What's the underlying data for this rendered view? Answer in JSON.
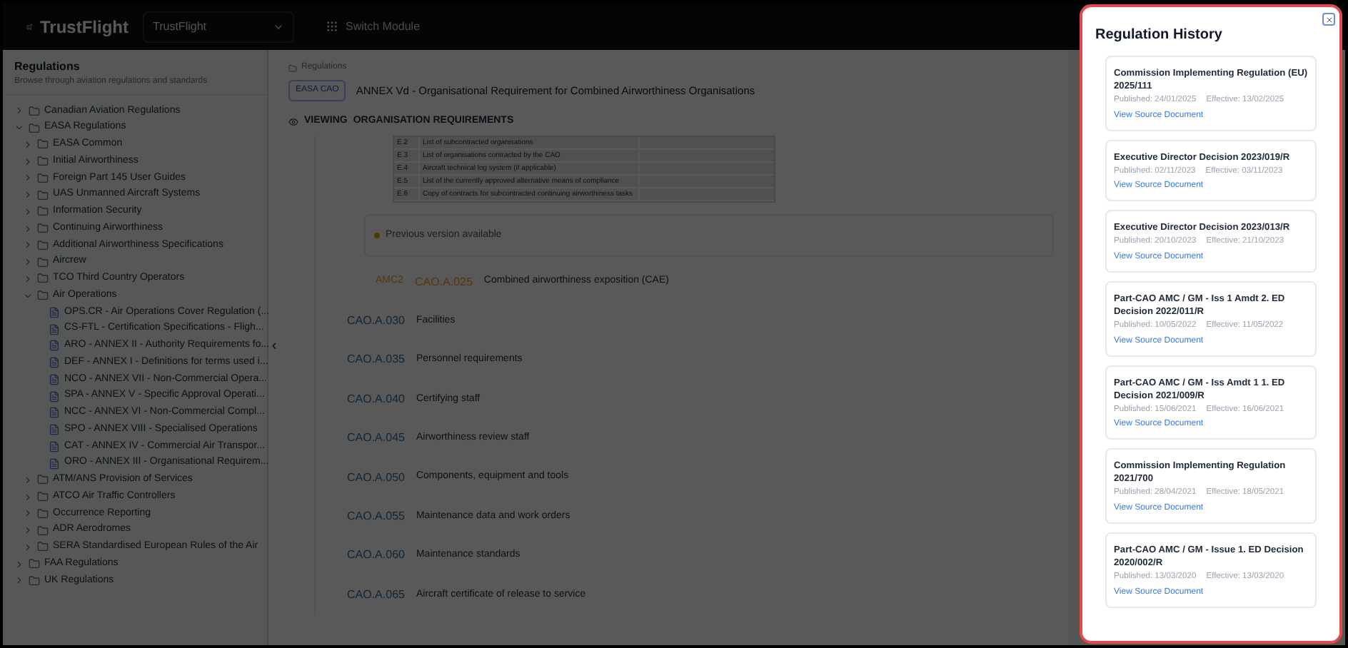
{
  "header": {
    "logo": "TrustFlight",
    "org_select": "TrustFlight",
    "switch_module": "Switch Module"
  },
  "sidebar": {
    "title": "Regulations",
    "subtitle": "Browse through aviation regulations and standards",
    "collapse": "‹",
    "items": [
      {
        "kind": "folder",
        "label": "Canadian Aviation Regulations",
        "expanded": false
      },
      {
        "kind": "folder",
        "label": "EASA Regulations",
        "expanded": true,
        "children": [
          {
            "kind": "folder",
            "label": "EASA Common",
            "expanded": false
          },
          {
            "kind": "folder",
            "label": "Initial Airworthiness",
            "expanded": false
          },
          {
            "kind": "folder",
            "label": "Foreign Part 145 User Guides",
            "expanded": false
          },
          {
            "kind": "folder",
            "label": "UAS Unmanned Aircraft Systems",
            "expanded": false
          },
          {
            "kind": "folder",
            "label": "Information Security",
            "expanded": false
          },
          {
            "kind": "folder",
            "label": "Continuing Airworthiness",
            "expanded": false
          },
          {
            "kind": "folder",
            "label": "Additional Airworthiness Specifications",
            "expanded": false
          },
          {
            "kind": "folder",
            "label": "Aircrew",
            "expanded": false
          },
          {
            "kind": "folder",
            "label": "TCO Third Country Operators",
            "expanded": false
          },
          {
            "kind": "folder",
            "label": "Air Operations",
            "expanded": true,
            "children": [
              {
                "kind": "document",
                "label": "OPS.CR - Air Operations Cover Regulation (..."
              },
              {
                "kind": "document",
                "label": "CS-FTL - Certification Specifications - Fligh..."
              },
              {
                "kind": "document",
                "label": "ARO - ANNEX II - Authority Requirements fo..."
              },
              {
                "kind": "document",
                "label": "DEF - ANNEX I - Definitions for terms used i..."
              },
              {
                "kind": "document",
                "label": "NCO - ANNEX VII - Non-Commercial Opera..."
              },
              {
                "kind": "document",
                "label": "SPA - ANNEX V - Specific Approval Operati..."
              },
              {
                "kind": "document",
                "label": "NCC - ANNEX VI - Non-Commercial Compl..."
              },
              {
                "kind": "document",
                "label": "SPO - ANNEX VIII - Specialised Operations"
              },
              {
                "kind": "document",
                "label": "CAT - ANNEX IV - Commercial Air Transpor..."
              },
              {
                "kind": "document",
                "label": "ORO - ANNEX III - Organisational Requirem..."
              }
            ]
          },
          {
            "kind": "folder",
            "label": "ATM/ANS Provision of Services",
            "expanded": false
          },
          {
            "kind": "folder",
            "label": "ATCO Air Traffic Controllers",
            "expanded": false
          },
          {
            "kind": "folder",
            "label": "Occurrence Reporting",
            "expanded": false
          },
          {
            "kind": "folder",
            "label": "ADR Aerodromes",
            "expanded": false
          },
          {
            "kind": "folder",
            "label": "SERA Standardised European Rules of the Air",
            "expanded": false
          }
        ]
      },
      {
        "kind": "folder",
        "label": "FAA Regulations",
        "expanded": false
      },
      {
        "kind": "folder",
        "label": "UK Regulations",
        "expanded": false
      }
    ]
  },
  "main": {
    "breadcrumb": "Regulations",
    "badge": "EASA CAO",
    "title": "ANNEX Vd - Organisational Requirement for Combined Airworthiness Organisations",
    "viewing_label": "VIEWING",
    "viewing_value": "ORGANISATION REQUIREMENTS",
    "table_rows": [
      {
        "code": "E.2",
        "text": "List of subcontracted organisations"
      },
      {
        "code": "E.3",
        "text": "List of organisations contracted by the CAO"
      },
      {
        "code": "E.4",
        "text": "Aircraft technical log system (if applicable)"
      },
      {
        "code": "E.5",
        "text": "List of the currently approved alternative means of compliance"
      },
      {
        "code": "E.6",
        "text": "Copy of contracts for subcontracted continuing airworthiness tasks"
      }
    ],
    "notice": "Previous version available",
    "sections": [
      {
        "tag": "AMC2",
        "code": "CAO.A.025",
        "title": "Combined airworthiness exposition (CAE)",
        "highlighted": true
      },
      {
        "code": "CAO.A.030",
        "title": "Facilities",
        "highlighted": false
      },
      {
        "code": "CAO.A.035",
        "title": "Personnel requirements",
        "highlighted": false
      },
      {
        "code": "CAO.A.040",
        "title": "Certifying staff",
        "highlighted": false
      },
      {
        "code": "CAO.A.045",
        "title": "Airworthiness review staff",
        "highlighted": false
      },
      {
        "code": "CAO.A.050",
        "title": "Components, equipment and tools",
        "highlighted": false
      },
      {
        "code": "CAO.A.055",
        "title": "Maintenance data and work orders",
        "highlighted": false
      },
      {
        "code": "CAO.A.060",
        "title": "Maintenance standards",
        "highlighted": false
      },
      {
        "code": "CAO.A.065",
        "title": "Aircraft certificate of release to service",
        "highlighted": false
      }
    ]
  },
  "history_panel": {
    "title": "Regulation History",
    "entries": [
      {
        "title": "Commission Implementing Regulation (EU) 2025/111",
        "published": "Published: 24/01/2025",
        "effective": "Effective: 13/02/2025",
        "link": "View Source Document"
      },
      {
        "title": "Executive Director Decision 2023/019/R",
        "published": "Published: 02/11/2023",
        "effective": "Effective: 03/11/2023",
        "link": "View Source Document"
      },
      {
        "title": "Executive Director Decision 2023/013/R",
        "published": "Published: 20/10/2023",
        "effective": "Effective: 21/10/2023",
        "link": "View Source Document"
      },
      {
        "title": "Part-CAO AMC / GM - Iss 1 Amdt 2. ED Decision 2022/011/R",
        "published": "Published: 10/05/2022",
        "effective": "Effective: 11/05/2022",
        "link": "View Source Document"
      },
      {
        "title": "Part-CAO AMC / GM - Iss Amdt 1 1. ED Decision 2021/009/R",
        "published": "Published: 15/06/2021",
        "effective": "Effective: 16/06/2021",
        "link": "View Source Document"
      },
      {
        "title": "Commission Implementing Regulation 2021/700",
        "published": "Published: 28/04/2021",
        "effective": "Effective: 18/05/2021",
        "link": "View Source Document"
      },
      {
        "title": "Part-CAO AMC / GM - Issue 1. ED Decision 2020/002/R",
        "published": "Published: 13/03/2020",
        "effective": "Effective: 13/03/2020",
        "link": "View Source Document"
      }
    ]
  }
}
